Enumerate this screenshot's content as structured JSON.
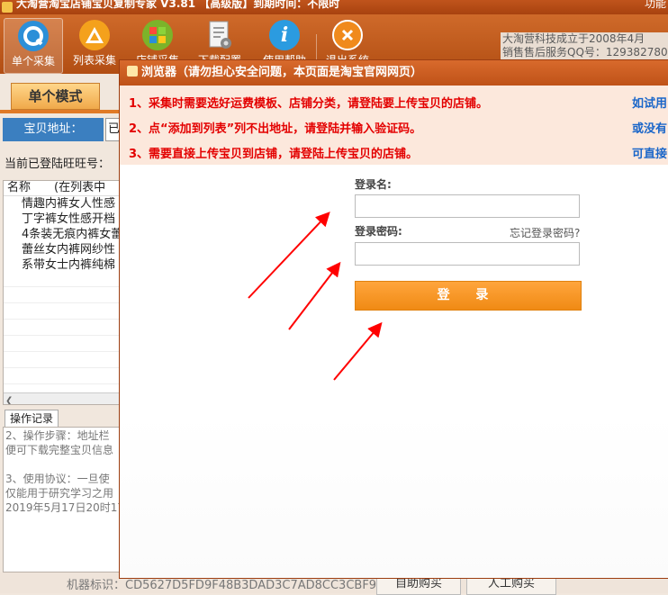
{
  "window": {
    "title": "大淘营淘宝店铺宝贝复制专家 V3.81 【高级版】到期时间：不限时",
    "right_text": "功能"
  },
  "toolbar": {
    "buttons": [
      {
        "label": "单个采集",
        "icon": "single-collect-icon"
      },
      {
        "label": "列表采集",
        "icon": "list-collect-icon"
      },
      {
        "label": "店铺采集",
        "icon": "shop-collect-icon"
      },
      {
        "label": "下载配置",
        "icon": "download-config-icon"
      },
      {
        "label": "使用帮助",
        "icon": "info-icon"
      },
      {
        "label": "退出系统",
        "icon": "close-icon"
      }
    ],
    "company_line1": "大淘营科技成立于2008年4月",
    "company_line2": "销售售后服务QQ号：129382780"
  },
  "left_panel": {
    "mode_tab": "单个模式",
    "addr_label": "宝贝地址：",
    "addr_value": "已",
    "login_label": "当前已登陆旺旺号：",
    "list_headers": [
      "名称",
      "(在列表中"
    ],
    "list_items": [
      "情趣内裤女人性感",
      "丁字裤女性感开档",
      "4条装无痕内裤女蕾",
      "蕾丝女内裤网纱性",
      "系带女士内裤纯棉"
    ],
    "log_tab": "操作记录",
    "log_lines": [
      "2、操作步骤：地址栏",
      "便可下载完整宝贝信息",
      "",
      "3、使用协议：一旦使",
      "仅能用于研究学习之用",
      "2019年5月17日20时17"
    ]
  },
  "status": {
    "machine_id": "机器标识：CD5627D5FD9F48B3DAD3C7AD8CC3CBF9",
    "btn_auto": "自助购买",
    "btn_manual": "人工购买"
  },
  "popup": {
    "title": "浏览器（请勿担心安全问题，本页面是淘宝官网网页）",
    "notices": [
      "1、采集时需要选好运费模板、店铺分类，请登陆要上传宝贝的店铺。",
      "2、点“添加到列表”列不出地址，请登陆并输入验证码。",
      "3、需要直接上传宝贝到店铺，请登陆上传宝贝的店铺。"
    ],
    "links": [
      "如试用",
      "或没有",
      "可直接"
    ],
    "username_label": "登录名:",
    "password_label": "登录密码:",
    "forgot": "忘记登录密码?",
    "login_button": "登 录"
  },
  "colors": {
    "brand_orange": "#c4561a",
    "notice_red": "#e30000",
    "link_blue": "#1a66c9",
    "login_button": "#f5951f",
    "arrow_red": "#ff0000"
  }
}
